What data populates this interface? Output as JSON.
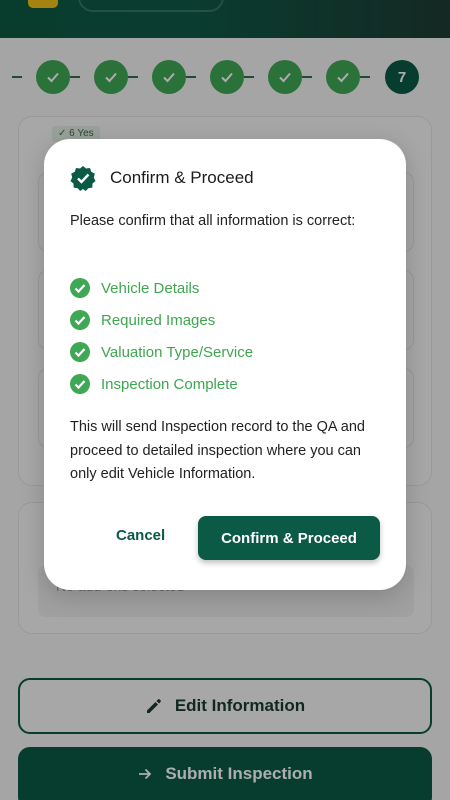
{
  "colors": {
    "primary": "#0b5a45",
    "success": "#3ea855",
    "check_text": "#3ea64f"
  },
  "stepper": {
    "steps": [
      {
        "state": "done",
        "icon": "check-icon"
      },
      {
        "state": "done",
        "icon": "check-icon"
      },
      {
        "state": "done",
        "icon": "check-icon"
      },
      {
        "state": "done",
        "icon": "check-icon"
      },
      {
        "state": "done",
        "icon": "check-icon"
      },
      {
        "state": "done",
        "icon": "check-icon"
      },
      {
        "state": "current",
        "label": "7"
      }
    ]
  },
  "background": {
    "chip_label": "✓ 6 Yes",
    "selection_text": "No add-ons selected"
  },
  "buttons": {
    "edit_label": "Edit Information",
    "submit_label": "Submit Inspection"
  },
  "dialog": {
    "title": "Confirm & Proceed",
    "message": "Please confirm that all information is correct:",
    "checklist": [
      "Vehicle Details",
      "Required Images",
      "Valuation Type/Service",
      "Inspection Complete"
    ],
    "note": "This will send Inspection record to the QA and proceed to detailed inspection where you can only edit Vehicle Information.",
    "cancel_label": "Cancel",
    "confirm_label": "Confirm & Proceed"
  }
}
